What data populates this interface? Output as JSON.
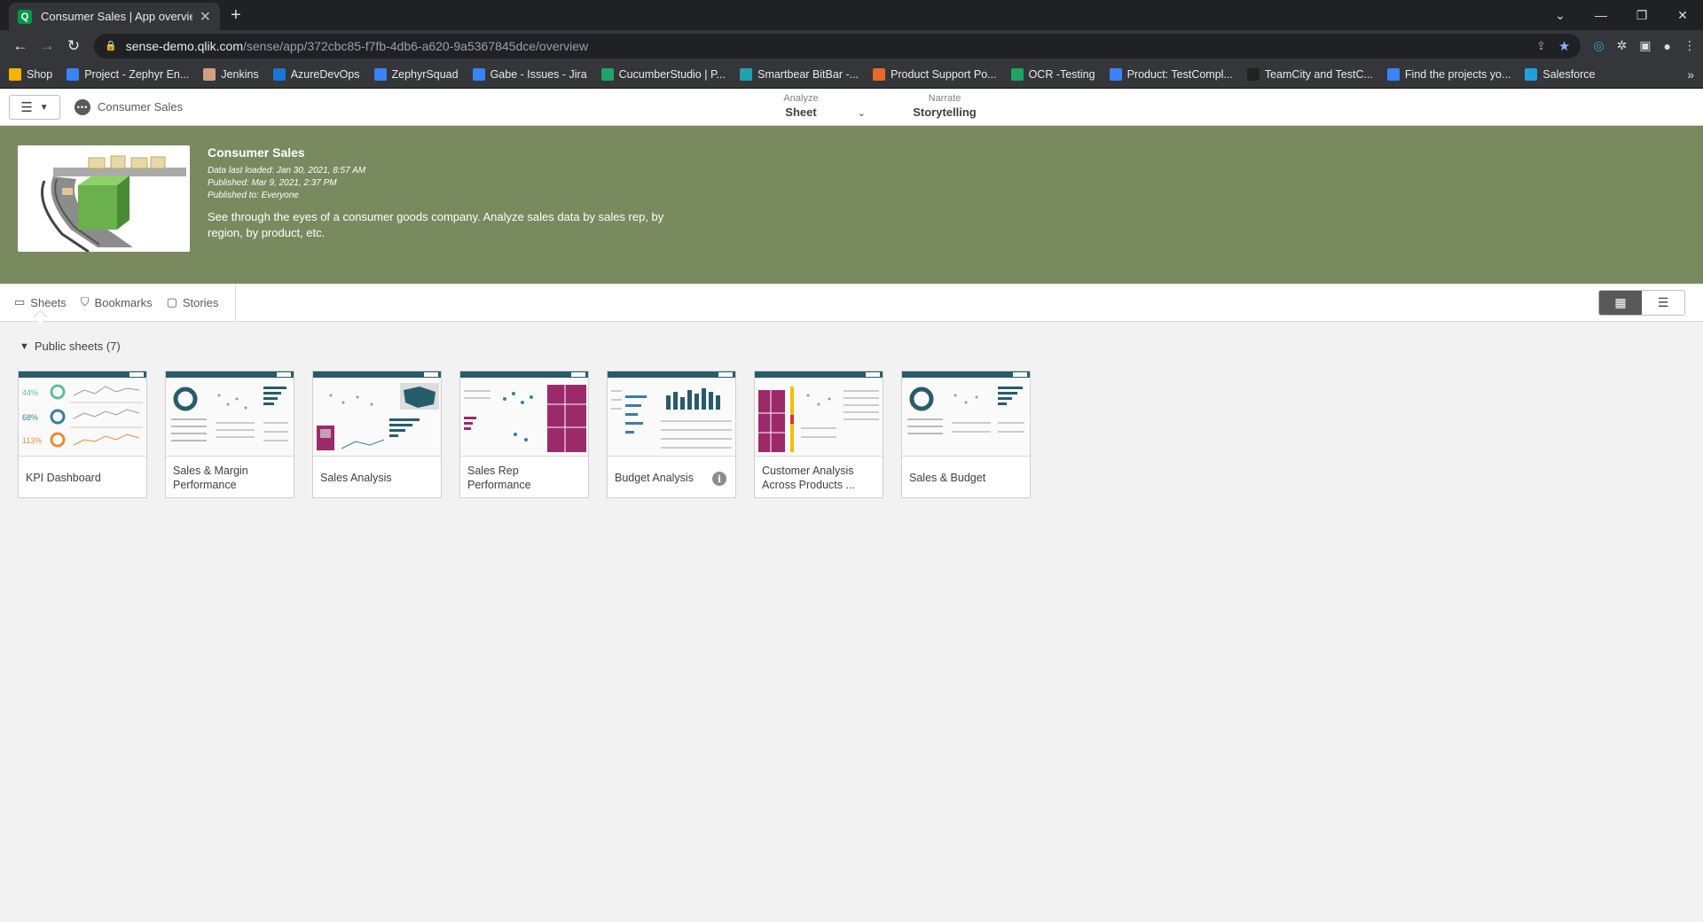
{
  "browser": {
    "tab_title": "Consumer Sales | App overview -",
    "url_host": "sense-demo.qlik.com",
    "url_path": "/sense/app/372cbc85-f7fb-4db6-a620-9a5367845dce/overview",
    "bookmarks": [
      {
        "label": "Shop",
        "color": "#f4b400"
      },
      {
        "label": "Project - Zephyr En...",
        "color": "#3b82f6"
      },
      {
        "label": "Jenkins",
        "color": "#d0a080"
      },
      {
        "label": "AzureDevOps",
        "color": "#1976d2"
      },
      {
        "label": "ZephyrSquad",
        "color": "#3b82f6"
      },
      {
        "label": "Gabe - Issues - Jira",
        "color": "#3b82f6"
      },
      {
        "label": "CucumberStudio | P...",
        "color": "#21a366"
      },
      {
        "label": "Smartbear BitBar -...",
        "color": "#22a0b0"
      },
      {
        "label": "Product Support Po...",
        "color": "#e86a2a"
      },
      {
        "label": "OCR -Testing",
        "color": "#21a366"
      },
      {
        "label": "Product: TestCompl...",
        "color": "#3b82f6"
      },
      {
        "label": "TeamCity and TestC...",
        "color": "#222222"
      },
      {
        "label": "Find the projects yo...",
        "color": "#3b82f6"
      },
      {
        "label": "Salesforce",
        "color": "#1ea0e0"
      }
    ]
  },
  "toolbar": {
    "app_name": "Consumer Sales",
    "analyze_label": "Analyze",
    "analyze_value": "Sheet",
    "narrate_label": "Narrate",
    "narrate_value": "Storytelling"
  },
  "banner": {
    "title": "Consumer Sales",
    "data_loaded": "Data last loaded: Jan 30, 2021, 8:57 AM",
    "published": "Published: Mar 9, 2021, 2:37 PM",
    "published_to": "Published to: Everyone",
    "description": "See through the eyes of a consumer goods company.  Analyze sales data by sales rep, by region, by product, etc.",
    "color": "#7a8a5f"
  },
  "subnav": {
    "sheets": "Sheets",
    "bookmarks": "Bookmarks",
    "stories": "Stories"
  },
  "section": {
    "title": "Public sheets (7)"
  },
  "sheets": [
    {
      "title": "KPI Dashboard"
    },
    {
      "title": "Sales & Margin Performance"
    },
    {
      "title": "Sales Analysis"
    },
    {
      "title": "Sales Rep Performance"
    },
    {
      "title": "Budget Analysis"
    },
    {
      "title": "Customer Analysis Across Products ..."
    },
    {
      "title": "Sales & Budget"
    }
  ],
  "kpi_thumb": {
    "v1": "44%",
    "v2": "68%",
    "v3": "113%"
  }
}
